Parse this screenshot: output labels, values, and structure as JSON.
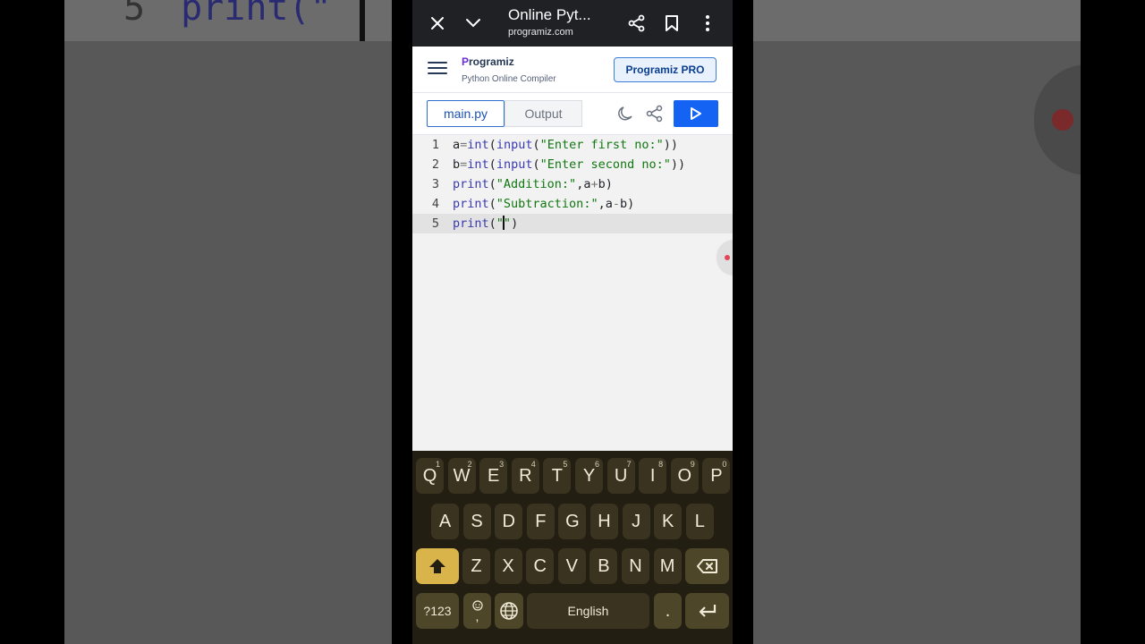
{
  "background": {
    "code_line_number": "5",
    "code_text": "print(\""
  },
  "browser": {
    "title": "Online Pyt...",
    "url": "programiz.com"
  },
  "app": {
    "logo_text": "rogramiz",
    "logo_mark": "P",
    "subtitle": "Python Online Compiler",
    "pro_button": "Programiz PRO"
  },
  "tabs": {
    "main": "main.py",
    "output": "Output"
  },
  "code": {
    "lines": [
      {
        "num": "1",
        "parts": [
          [
            "",
            "a"
          ],
          [
            "o",
            "="
          ],
          [
            "k",
            "int"
          ],
          [
            "",
            "("
          ],
          [
            "k",
            "input"
          ],
          [
            "",
            "("
          ],
          [
            "s",
            "\"Enter first no:\""
          ],
          [
            "",
            "))"
          ]
        ]
      },
      {
        "num": "2",
        "parts": [
          [
            "",
            "b"
          ],
          [
            "o",
            "="
          ],
          [
            "k",
            "int"
          ],
          [
            "",
            "("
          ],
          [
            "k",
            "input"
          ],
          [
            "",
            "("
          ],
          [
            "s",
            "\"Enter second no:\""
          ],
          [
            "",
            "))"
          ]
        ]
      },
      {
        "num": "3",
        "parts": [
          [
            "k",
            "print"
          ],
          [
            "",
            "("
          ],
          [
            "s",
            "\"Addition:\""
          ],
          [
            "",
            ",a"
          ],
          [
            "o",
            "+"
          ],
          [
            "",
            "b)"
          ]
        ]
      },
      {
        "num": "4",
        "parts": [
          [
            "k",
            "print"
          ],
          [
            "",
            "("
          ],
          [
            "s",
            "\"Subtraction:\""
          ],
          [
            "",
            ",a"
          ],
          [
            "o",
            "-"
          ],
          [
            "",
            "b)"
          ]
        ]
      },
      {
        "num": "5",
        "parts": [
          [
            "k",
            "print"
          ],
          [
            "",
            "("
          ],
          [
            "s",
            "\""
          ],
          [
            "cursor",
            ""
          ],
          [
            "s",
            "\""
          ],
          [
            "",
            ")"
          ]
        ]
      }
    ],
    "active_line": 5
  },
  "keyboard": {
    "row1": [
      [
        "Q",
        "1"
      ],
      [
        "W",
        "2"
      ],
      [
        "E",
        "3"
      ],
      [
        "R",
        "4"
      ],
      [
        "T",
        "5"
      ],
      [
        "Y",
        "6"
      ],
      [
        "U",
        "7"
      ],
      [
        "I",
        "8"
      ],
      [
        "O",
        "9"
      ],
      [
        "P",
        "0"
      ]
    ],
    "row2": [
      "A",
      "S",
      "D",
      "F",
      "G",
      "H",
      "J",
      "K",
      "L"
    ],
    "row3": [
      "Z",
      "X",
      "C",
      "V",
      "B",
      "N",
      "M"
    ],
    "symbols_key": "?123",
    "comma_key": ",",
    "space_label": "English",
    "period_key": "."
  },
  "colors": {
    "run_button": "#1463f3",
    "keyboard_bg": "#231e12",
    "shift_accent": "#d9b44a"
  }
}
